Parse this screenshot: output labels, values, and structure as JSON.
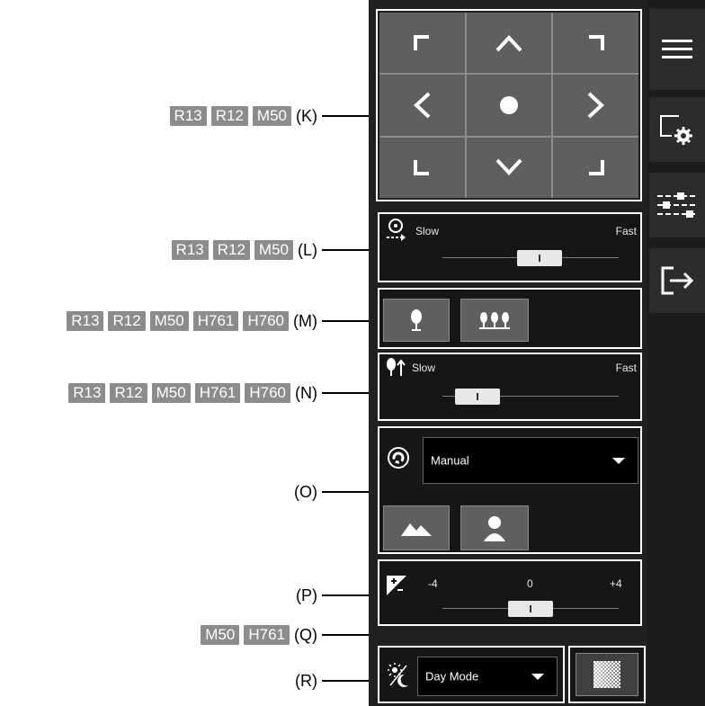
{
  "callouts": {
    "K": {
      "tags": [
        "R13",
        "R12",
        "M50"
      ],
      "letter": "(K)"
    },
    "L": {
      "tags": [
        "R13",
        "R12",
        "M50"
      ],
      "letter": "(L)"
    },
    "M": {
      "tags": [
        "R13",
        "R12",
        "M50",
        "H761",
        "H760"
      ],
      "letter": "(M)"
    },
    "N": {
      "tags": [
        "R13",
        "R12",
        "M50",
        "H761",
        "H760"
      ],
      "letter": "(N)"
    },
    "O": {
      "tags": [],
      "letter": "(O)"
    },
    "P": {
      "tags": [],
      "letter": "(P)"
    },
    "Q": {
      "tags": [
        "M50",
        "H761"
      ],
      "letter": "(Q)"
    },
    "R": {
      "tags": [],
      "letter": "(R)"
    }
  },
  "pan_speed": {
    "slow_label": "Slow",
    "fast_label": "Fast",
    "level": 0.55
  },
  "focus_mode_buttons": [
    "tree-single-icon",
    "tree-multiple-icon"
  ],
  "focus_speed": {
    "slow_label": "Slow",
    "fast_label": "Fast",
    "level": 0.2
  },
  "focus_preset": {
    "value": "Manual",
    "buttons": [
      "landscape-icon",
      "portrait-icon"
    ]
  },
  "exposure": {
    "min_label": "-4",
    "mid_label": "0",
    "max_label": "+4",
    "level": 0.5
  },
  "day_night": {
    "value": "Day Mode"
  },
  "sidebar_icons": [
    "menu-icon",
    "camera-settings-icon",
    "sliders-icon",
    "exit-icon"
  ],
  "colors": {
    "panel": "#202020",
    "tag": "#8c8c8c",
    "button": "#5f5f5f"
  }
}
